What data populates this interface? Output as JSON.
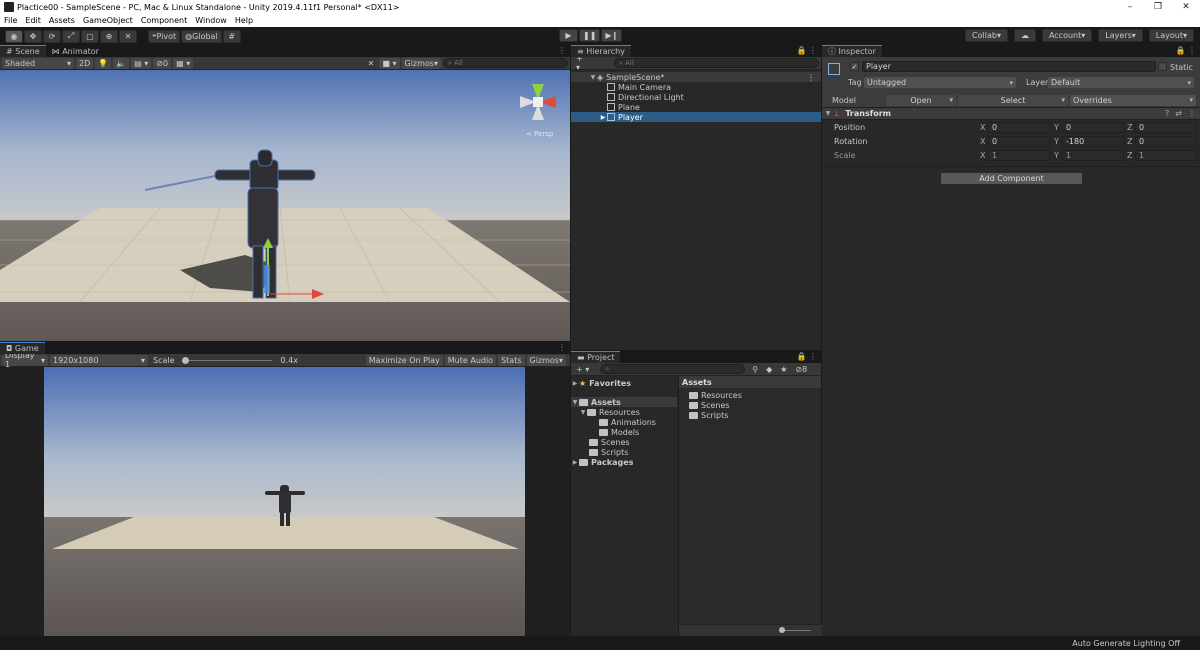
{
  "window": {
    "title": "Plactice00 - SampleScene - PC, Mac & Linux Standalone - Unity 2019.4.11f1 Personal* <DX11>",
    "minimize": "–",
    "maximize": "❐",
    "close": "✕"
  },
  "menu": [
    "File",
    "Edit",
    "Assets",
    "GameObject",
    "Component",
    "Window",
    "Help"
  ],
  "toolbar": {
    "pivot_label": "Pivot",
    "global_label": "Global",
    "collab_label": "Collab",
    "account_label": "Account",
    "layers_label": "Layers",
    "layout_label": "Layout"
  },
  "scene": {
    "tab_scene": "Scene",
    "tab_animator": "Animator",
    "shading": "Shaded",
    "mode_2d": "2D",
    "hidden_count": "0",
    "gizmos": "Gizmos",
    "search_placeholder": "All",
    "persp": "< Persp"
  },
  "game": {
    "tab": "Game",
    "display": "Display 1",
    "resolution": "1920x1080",
    "scale_label": "Scale",
    "scale_value": "0.4x",
    "maximize": "Maximize On Play",
    "mute": "Mute Audio",
    "stats": "Stats",
    "gizmos": "Gizmos"
  },
  "hierarchy": {
    "tab": "Hierarchy",
    "search_placeholder": "All",
    "scene_name": "SampleScene*",
    "items": [
      "Main Camera",
      "Directional Light",
      "Plane",
      "Player"
    ],
    "selected": "Player"
  },
  "project": {
    "tab": "Project",
    "hidden_count": "8",
    "favorites": "Favorites",
    "assets": "Assets",
    "resources": "Resources",
    "animations": "Animations",
    "models": "Models",
    "scenes": "Scenes",
    "scripts": "Scripts",
    "packages": "Packages",
    "right_header": "Assets",
    "right_items": [
      "Resources",
      "Scenes",
      "Scripts"
    ]
  },
  "inspector": {
    "tab": "Inspector",
    "object_name": "Player",
    "static_label": "Static",
    "tag_label": "Tag",
    "tag_value": "Untagged",
    "layer_label": "Layer",
    "layer_value": "Default",
    "model_label": "Model",
    "open": "Open",
    "select": "Select",
    "overrides": "Overrides",
    "transform_title": "Transform",
    "position_label": "Position",
    "rotation_label": "Rotation",
    "scale_label": "Scale",
    "axis_x": "X",
    "axis_y": "Y",
    "axis_z": "Z",
    "position": {
      "x": "0",
      "y": "0",
      "z": "0"
    },
    "rotation": {
      "x": "0",
      "y": "-180",
      "z": "0"
    },
    "scale": {
      "x": "1",
      "y": "1",
      "z": "1"
    },
    "add_component": "Add Component"
  },
  "status": {
    "lighting": "Auto Generate Lighting Off"
  },
  "colors": {
    "selection": "#2c5d87",
    "accent_tab": "#3d86d6",
    "panel_bg": "#282828"
  }
}
